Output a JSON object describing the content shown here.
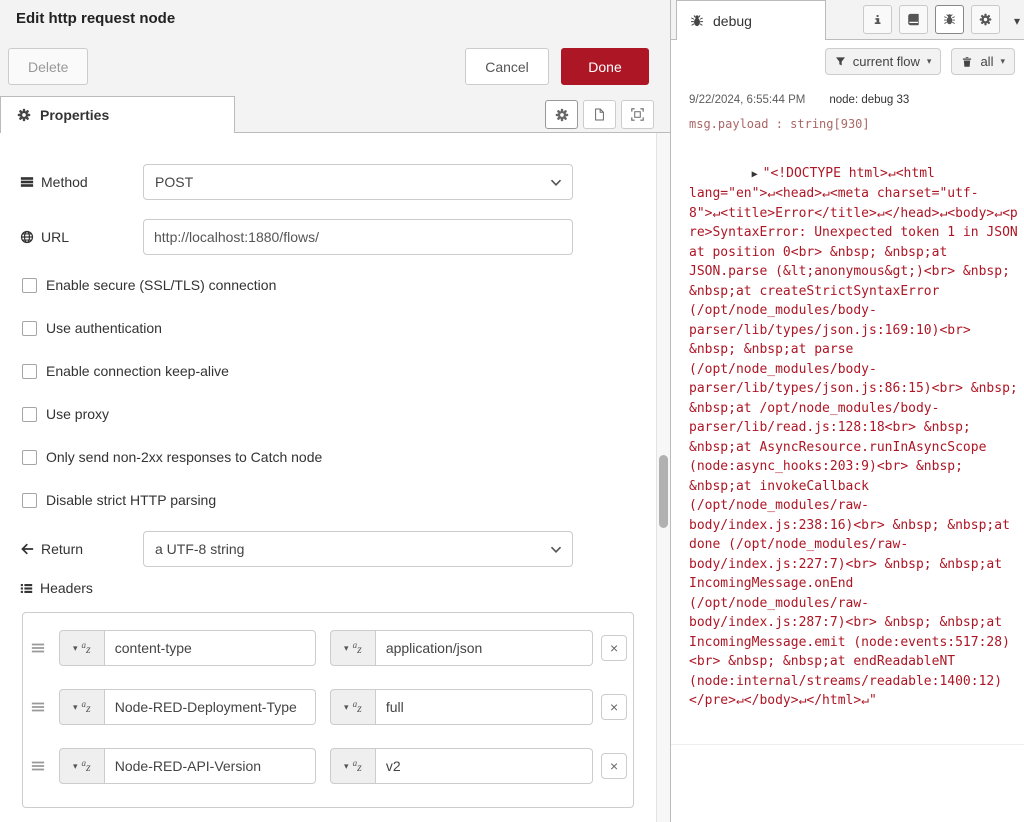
{
  "editor": {
    "title": "Edit http request node",
    "toolbar": {
      "delete_label": "Delete",
      "cancel_label": "Cancel",
      "done_label": "Done"
    },
    "tabs": {
      "properties_label": "Properties"
    },
    "form": {
      "method": {
        "label": "Method",
        "value": "POST"
      },
      "url": {
        "label": "URL",
        "value": "http://localhost:1880/flows/"
      },
      "options": [
        {
          "label": "Enable secure (SSL/TLS) connection",
          "checked": false
        },
        {
          "label": "Use authentication",
          "checked": false
        },
        {
          "label": "Enable connection keep-alive",
          "checked": false
        },
        {
          "label": "Use proxy",
          "checked": false
        },
        {
          "label": "Only send non-2xx responses to Catch node",
          "checked": false
        },
        {
          "label": "Disable strict HTTP parsing",
          "checked": false
        }
      ],
      "return": {
        "label": "Return",
        "value": "a UTF-8 string"
      },
      "headers": {
        "label": "Headers",
        "rows": [
          {
            "name": "content-type",
            "value": "application/json"
          },
          {
            "name": "Node-RED-Deployment-Type",
            "value": "full"
          },
          {
            "name": "Node-RED-API-Version",
            "value": "v2"
          }
        ]
      }
    }
  },
  "sidebar": {
    "tab_label": "debug",
    "filter": {
      "scope_label": "current flow",
      "clear_label": "all"
    },
    "message": {
      "timestamp": "9/22/2024, 6:55:44 PM",
      "source": "node: debug 33",
      "property": "msg.payload : string[930]",
      "payload": "\"<!DOCTYPE html>↵<html lang=\"en\">↵<head>↵<meta charset=\"utf-8\">↵<title>Error</title>↵</head>↵<body>↵<pre>SyntaxError: Unexpected token 1 in JSON at position 0<br> &nbsp; &nbsp;at JSON.parse (&lt;anonymous&gt;)<br> &nbsp; &nbsp;at createStrictSyntaxError (/opt/node_modules/body-parser/lib/types/json.js:169:10)<br> &nbsp; &nbsp;at parse (/opt/node_modules/body-parser/lib/types/json.js:86:15)<br> &nbsp; &nbsp;at /opt/node_modules/body-parser/lib/read.js:128:18<br> &nbsp; &nbsp;at AsyncResource.runInAsyncScope (node:async_hooks:203:9)<br> &nbsp; &nbsp;at invokeCallback (/opt/node_modules/raw-body/index.js:238:16)<br> &nbsp; &nbsp;at done (/opt/node_modules/raw-body/index.js:227:7)<br> &nbsp; &nbsp;at IncomingMessage.onEnd (/opt/node_modules/raw-body/index.js:287:7)<br> &nbsp; &nbsp;at IncomingMessage.emit (node:events:517:28)<br> &nbsp; &nbsp;at endReadableNT (node:internal/streams/readable:1400:12)</pre>↵</body>↵</html>↵\""
    }
  },
  "icons": {
    "caret_down": "▾",
    "expand_arrow": "▶",
    "remove": "×",
    "string_type_a": "a",
    "string_type_z": "z"
  },
  "colors": {
    "accent": "#AD1625",
    "debug_string": "#AD1625",
    "panel_header_bg": "#f3f3f3",
    "border": "#bbbbbb"
  }
}
